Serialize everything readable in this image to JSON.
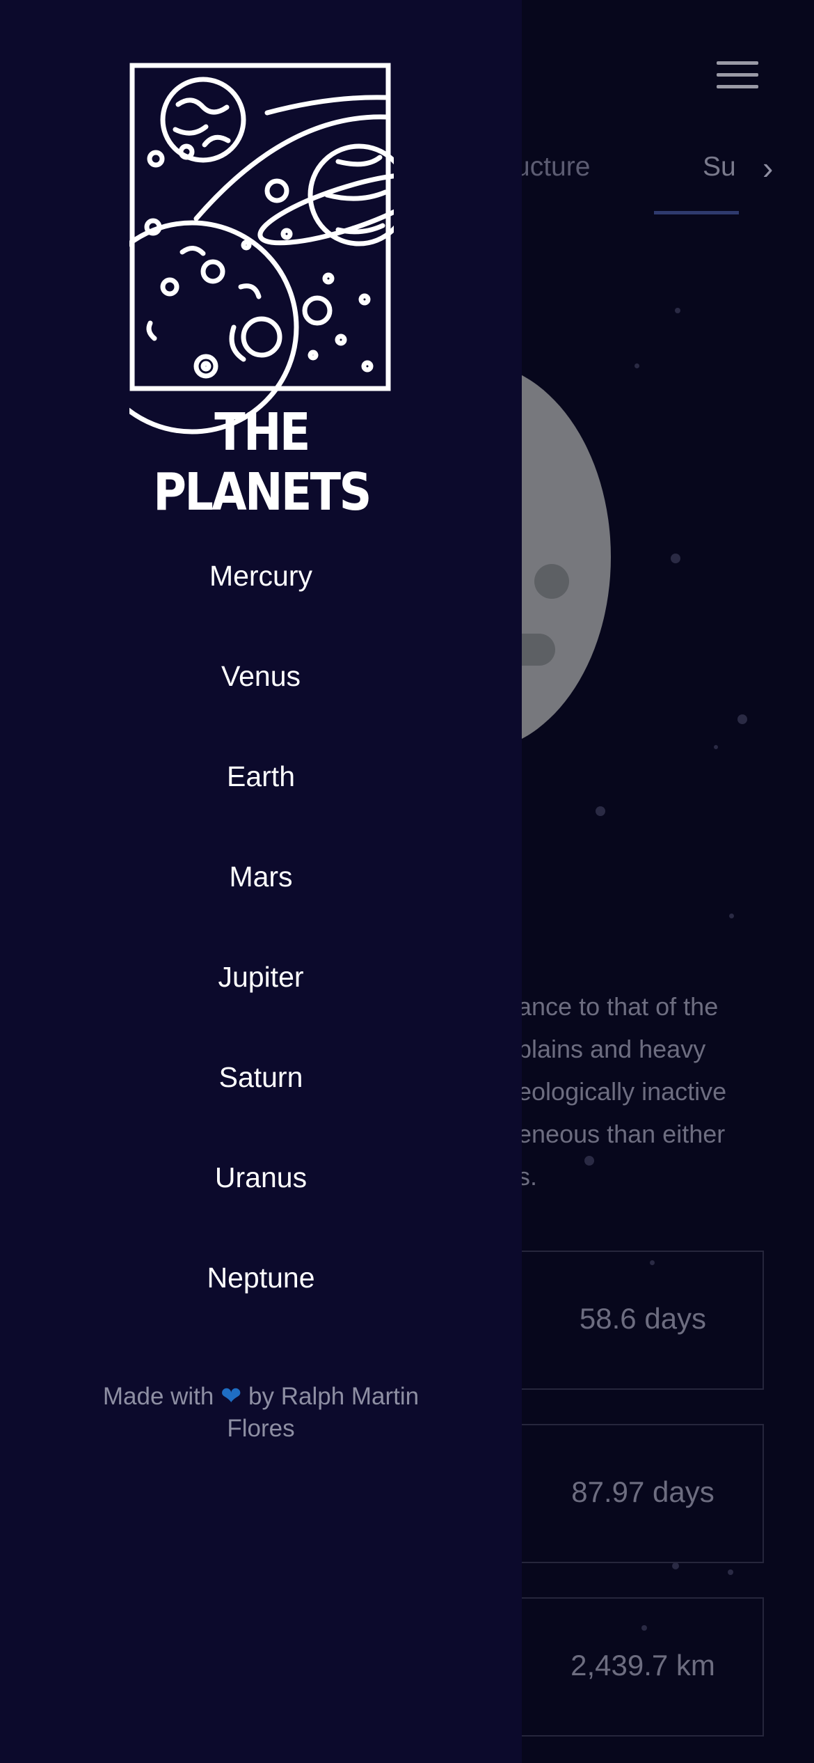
{
  "background_page": {
    "tabs": [
      "ucture",
      "Su"
    ],
    "description_lines": [
      "ance to that of the",
      "plains and heavy",
      "eologically inactive",
      "eneous than either",
      "s."
    ],
    "stats": [
      "58.6 days",
      "87.97 days",
      "2,439.7 km"
    ]
  },
  "drawer": {
    "logo_text": "THE PLANETS",
    "nav_items": [
      "Mercury",
      "Venus",
      "Earth",
      "Mars",
      "Jupiter",
      "Saturn",
      "Uranus",
      "Neptune"
    ],
    "credit": {
      "prefix": "Made with",
      "heart": "❤",
      "suffix": "by Ralph Martin Flores"
    }
  },
  "colors": {
    "drawer_background": "#0c0a2c",
    "page_background": "#07071c",
    "heart": "#1f6ec3",
    "nav_text": "#ffffff",
    "credit_text": "#8e8fa3"
  }
}
